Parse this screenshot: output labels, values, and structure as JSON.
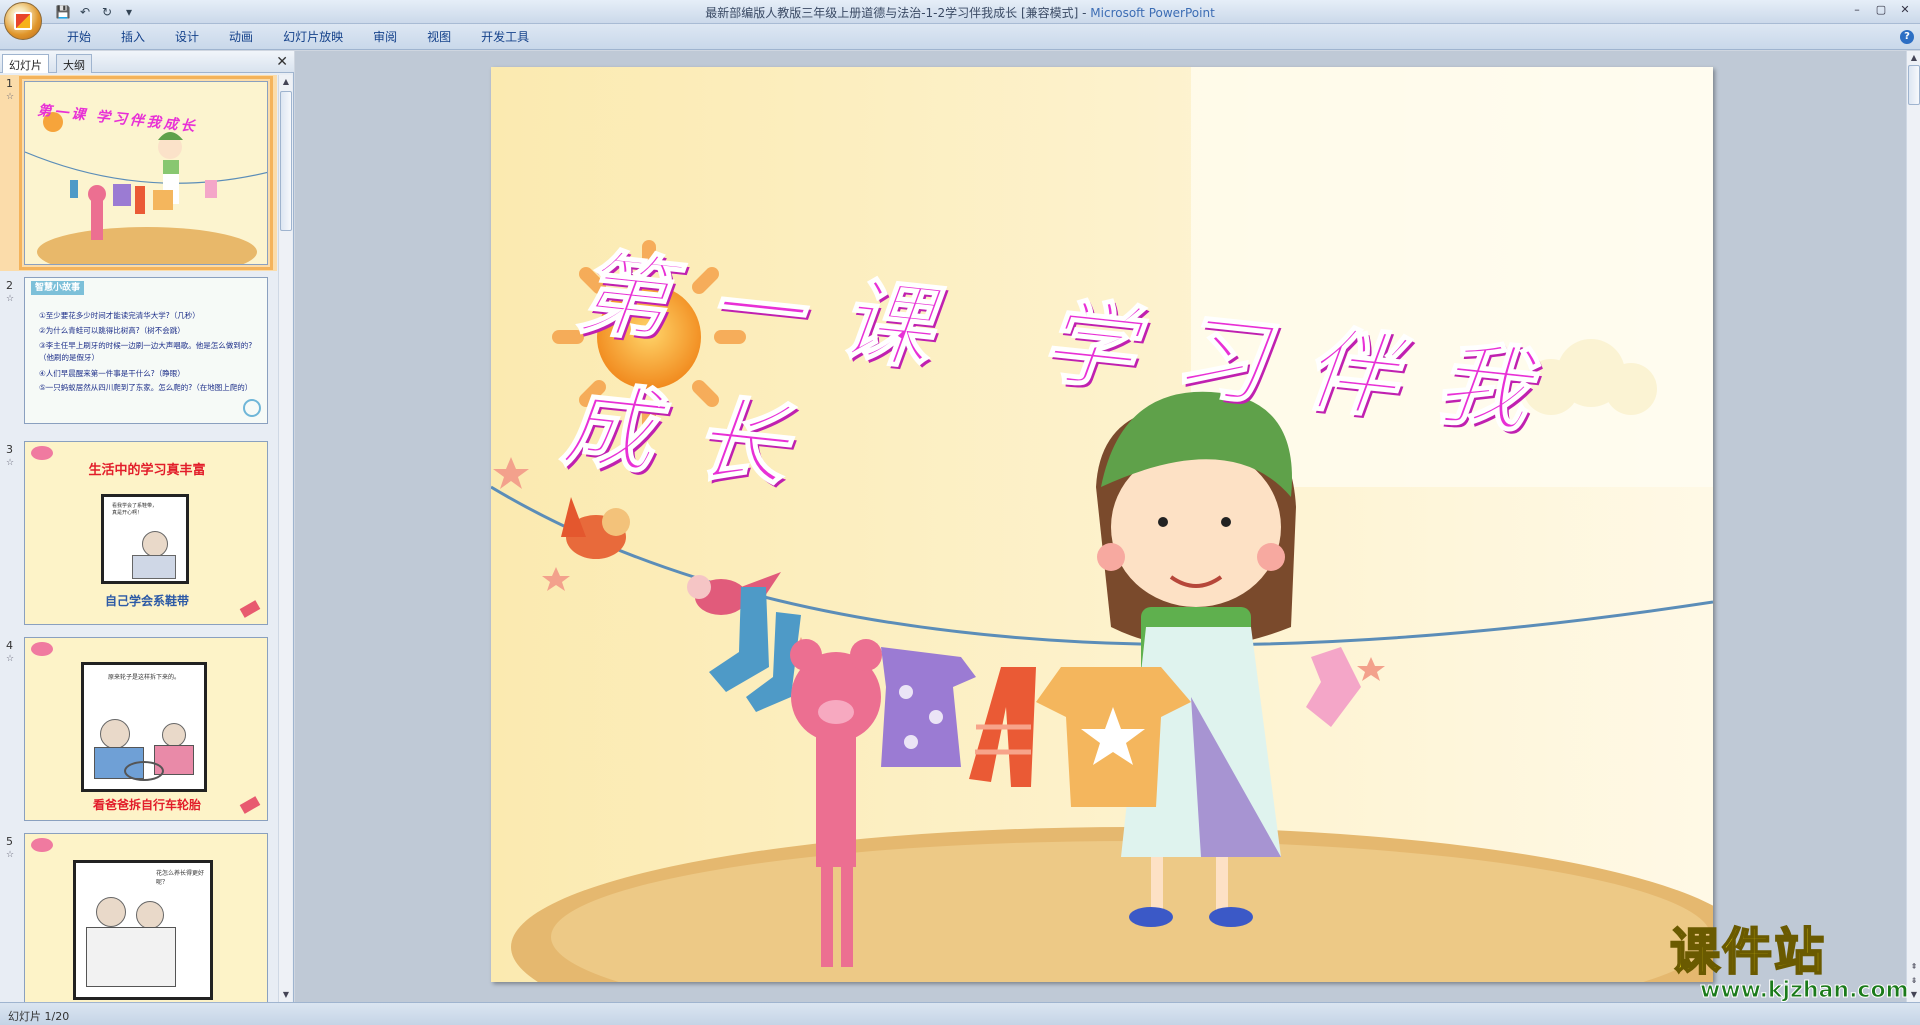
{
  "titlebar": {
    "title": "最新部编版人教版三年级上册道德与法治-1-2学习伴我成长 [兼容模式] - ",
    "app_name": "Microsoft PowerPoint"
  },
  "quick_access": {
    "save": "💾",
    "undo": "↶",
    "redo": "↻",
    "more": "▾"
  },
  "window_controls": {
    "minimize": "–",
    "maximize": "▢",
    "close": "✕"
  },
  "ribbon": {
    "tabs": [
      "开始",
      "插入",
      "设计",
      "动画",
      "幻灯片放映",
      "审阅",
      "视图",
      "开发工具"
    ],
    "help": "?"
  },
  "left_pane": {
    "tabs": [
      "幻灯片",
      "大纲"
    ],
    "close": "✕"
  },
  "thumbnails": [
    {
      "num": "1",
      "text": "第一课 学习伴我成长"
    },
    {
      "num": "2",
      "heading": "智慧小故事",
      "lines": [
        "①至少要花多少时间才能读完清华大学?（几秒）",
        "②为什么青蛙可以跳得比树高?（树不会跳）",
        "③李主任早上刷牙的时候一边刷一边大声唱歌。他是怎么做到的?（他刷的是假牙）",
        "④人们早晨醒来第一件事是干什么?（睁眼）",
        "⑤一只蚂蚁居然从四川爬到了东家。怎么爬的?（在地图上爬的）"
      ]
    },
    {
      "num": "3",
      "title": "生活中的学习真丰富",
      "caption": "自己学会系鞋带",
      "bubble": "看我学会了系鞋带，真是开心啊！"
    },
    {
      "num": "4",
      "caption": "看爸爸拆自行车轮胎",
      "bubble": "原来轮子是这样拆下来的。"
    },
    {
      "num": "5",
      "bubble": "花怎么养长得更好呢？"
    }
  ],
  "slide": {
    "title": "第一课  学习伴我成长"
  },
  "status": {
    "text": "幻灯片 1/20"
  },
  "watermark": {
    "main": "课件站",
    "url": "www.kjzhan.com"
  }
}
